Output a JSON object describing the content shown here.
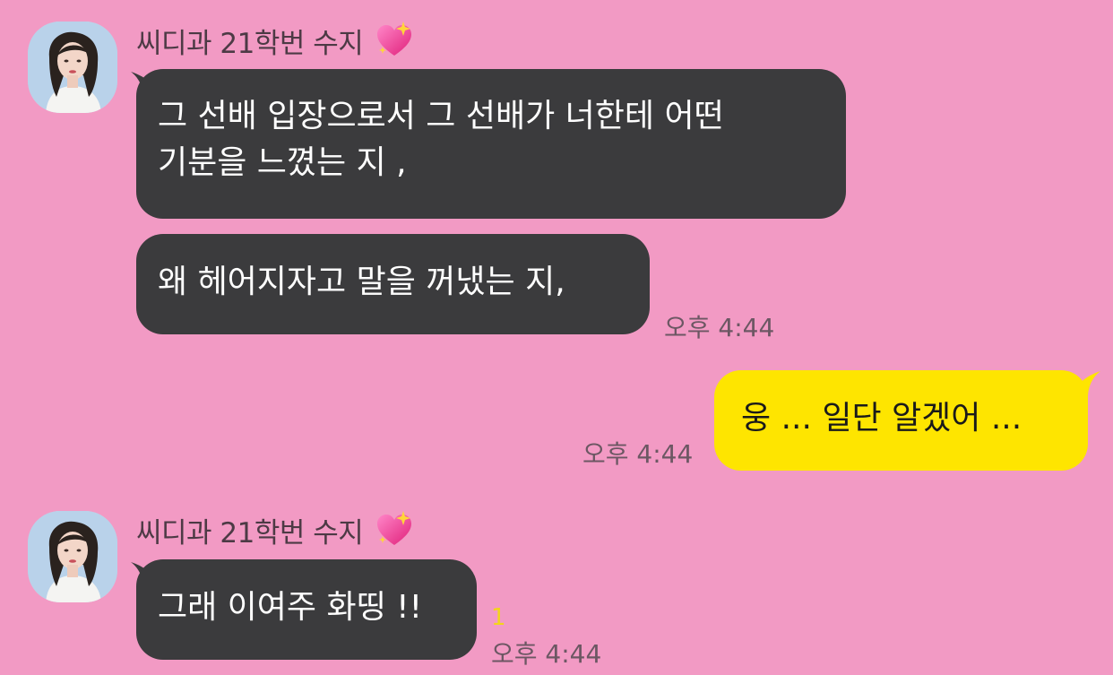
{
  "chat": {
    "messages": [
      {
        "sender": "씨디과 21학번 수지",
        "lines": [
          "그 선배 입장으로서 그 선배가 너한테 어떤",
          "기분을 느꼈는 지 ,"
        ]
      },
      {
        "lines": [
          "왜 헤어지자고 말을 꺼냈는 지,"
        ],
        "time": "오후 4:44"
      },
      {
        "outgoing": true,
        "lines": [
          "웅 ... 일단 알겠어 ..."
        ],
        "time": "오후 4:44"
      },
      {
        "sender": "씨디과 21학번 수지",
        "lines": [
          "그래 이여주 화띵 !!"
        ],
        "unread": "1",
        "time": "오후 4:44"
      }
    ]
  },
  "colors": {
    "background": "#f29ac4",
    "incoming_bubble": "#3b3b3d",
    "outgoing_bubble": "#fee500",
    "unread_count": "#f3d51a"
  },
  "icons": {
    "name_emoji": "sparkling-heart-icon",
    "avatar": "profile-photo"
  }
}
